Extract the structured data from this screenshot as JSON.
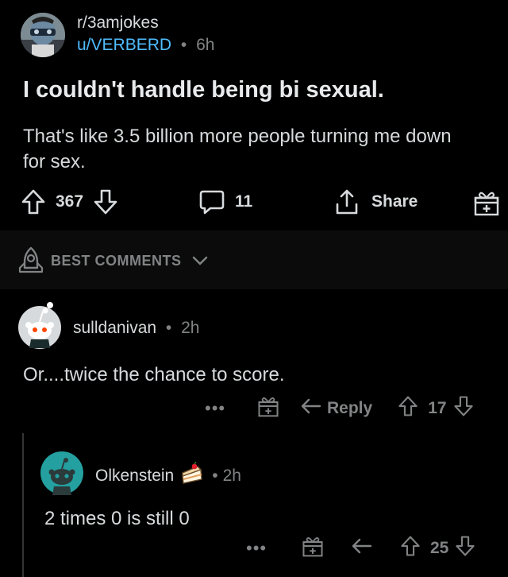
{
  "post": {
    "subreddit": "r/3amjokes",
    "author": "u/VERBERD",
    "separator": "•",
    "age": "6h",
    "title": "I couldn't handle being bi sexual.",
    "body": "That's like 3.5 billion more people turning me down for sex.",
    "upvotes": "367",
    "comments": "11",
    "share_label": "Share"
  },
  "sort": {
    "label": "BEST COMMENTS"
  },
  "comments": [
    {
      "author": "sulldanivan",
      "separator": "•",
      "age": "2h",
      "text": "Or....twice the chance to score.",
      "more": "•••",
      "reply_label": "Reply",
      "votes": "17"
    },
    {
      "author": "Olkenstein",
      "separator": "•",
      "age": "2h",
      "text": "2 times 0 is still 0",
      "more": "•••",
      "votes": "25"
    }
  ],
  "colors": {
    "background": "#000000",
    "sortbar": "#0b0b0b",
    "username_blue": "#4fbcff",
    "muted": "#818384",
    "text": "#d7dadc",
    "snoo_teal": "#24a0a0"
  },
  "icons": [
    "upvote-icon",
    "downvote-icon",
    "comment-icon",
    "share-icon",
    "gift-icon",
    "rocket-icon",
    "chevron-down-icon",
    "reply-icon",
    "cake-icon"
  ]
}
